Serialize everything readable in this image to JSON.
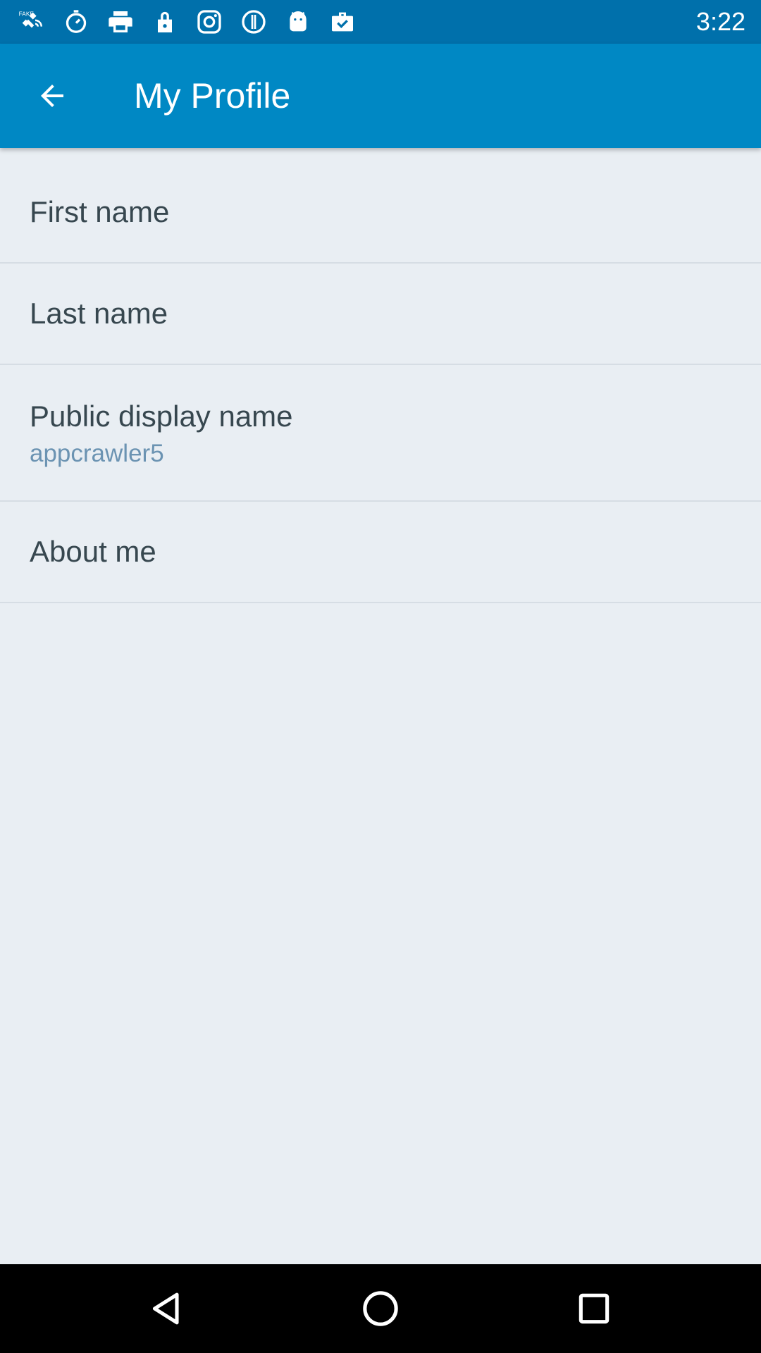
{
  "status_bar": {
    "time": "3:22",
    "icons": [
      "fake-gps-icon",
      "stopwatch-icon",
      "print-icon",
      "lock-icon",
      "instagram-icon",
      "info-icon",
      "android-icon",
      "briefcase-check-icon"
    ]
  },
  "app_bar": {
    "title": "My Profile",
    "back_icon": "arrow-back-icon"
  },
  "profile": {
    "first_name_label": "First name",
    "last_name_label": "Last name",
    "display_name_label": "Public display name",
    "display_name_value": "appcrawler5",
    "about_me_label": "About me"
  },
  "nav_bar": {
    "icons": [
      "back-triangle-icon",
      "home-circle-icon",
      "recents-square-icon"
    ]
  },
  "colors": {
    "status_bar": "#0070ab",
    "app_bar": "#0088c4",
    "background": "#e9eef3",
    "secondary_text": "#6b93b2"
  }
}
